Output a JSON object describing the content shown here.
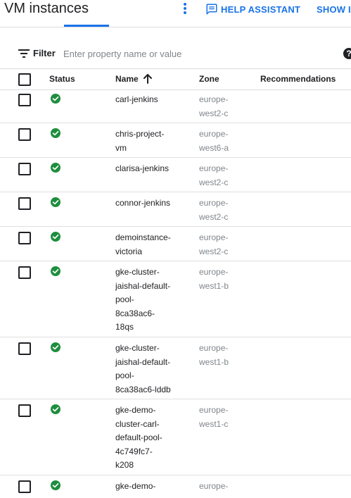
{
  "header": {
    "title": "VM instances",
    "more_icon": "more-vert-icon",
    "help_assistant_label": "HELP ASSISTANT",
    "help_assistant_icon": "chat-icon",
    "show_info_label": "SHOW IN"
  },
  "filter": {
    "label": "Filter",
    "placeholder": "Enter property name or value",
    "icon": "filter-list-icon",
    "help_icon": "help-circle-icon",
    "help_glyph": "?"
  },
  "table": {
    "columns": {
      "status": "Status",
      "name": "Name",
      "zone": "Zone",
      "recommendations": "Recommendations"
    },
    "sort": {
      "column": "name",
      "direction": "ascending",
      "icon": "arrow-upward-icon"
    },
    "status_color": "#1e8e3e",
    "rows": [
      {
        "status": "running",
        "name_lines": [
          "carl-jenkins"
        ],
        "zone_lines": [
          "europe-",
          "west2-c"
        ]
      },
      {
        "status": "running",
        "name_lines": [
          "chris-project-",
          "vm"
        ],
        "zone_lines": [
          "europe-",
          "west6-a"
        ]
      },
      {
        "status": "running",
        "name_lines": [
          "clarisa-jenkins"
        ],
        "zone_lines": [
          "europe-",
          "west2-c"
        ]
      },
      {
        "status": "running",
        "name_lines": [
          "connor-jenkins"
        ],
        "zone_lines": [
          "europe-",
          "west2-c"
        ]
      },
      {
        "status": "running",
        "name_lines": [
          "demoinstance-",
          "victoria"
        ],
        "zone_lines": [
          "europe-",
          "west2-c"
        ]
      },
      {
        "status": "running",
        "name_lines": [
          "gke-cluster-",
          "jaishal-default-",
          "pool-",
          "8ca38ac6-",
          "18qs"
        ],
        "zone_lines": [
          "europe-",
          "west1-b"
        ]
      },
      {
        "status": "running",
        "name_lines": [
          "gke-cluster-",
          "jaishal-default-",
          "pool-",
          "8ca38ac6-lddb"
        ],
        "zone_lines": [
          "europe-",
          "west1-b"
        ]
      },
      {
        "status": "running",
        "name_lines": [
          "gke-demo-",
          "cluster-carl-",
          "default-pool-",
          "4c749fc7-",
          "k208"
        ],
        "zone_lines": [
          "europe-",
          "west1-c"
        ]
      },
      {
        "status": "running",
        "name_lines": [
          "gke-demo-"
        ],
        "zone_lines": [
          "europe-"
        ]
      }
    ]
  },
  "colors": {
    "accent": "#1a73e8",
    "text": "#202124",
    "muted": "#80868b",
    "divider": "#e0e0e0"
  }
}
